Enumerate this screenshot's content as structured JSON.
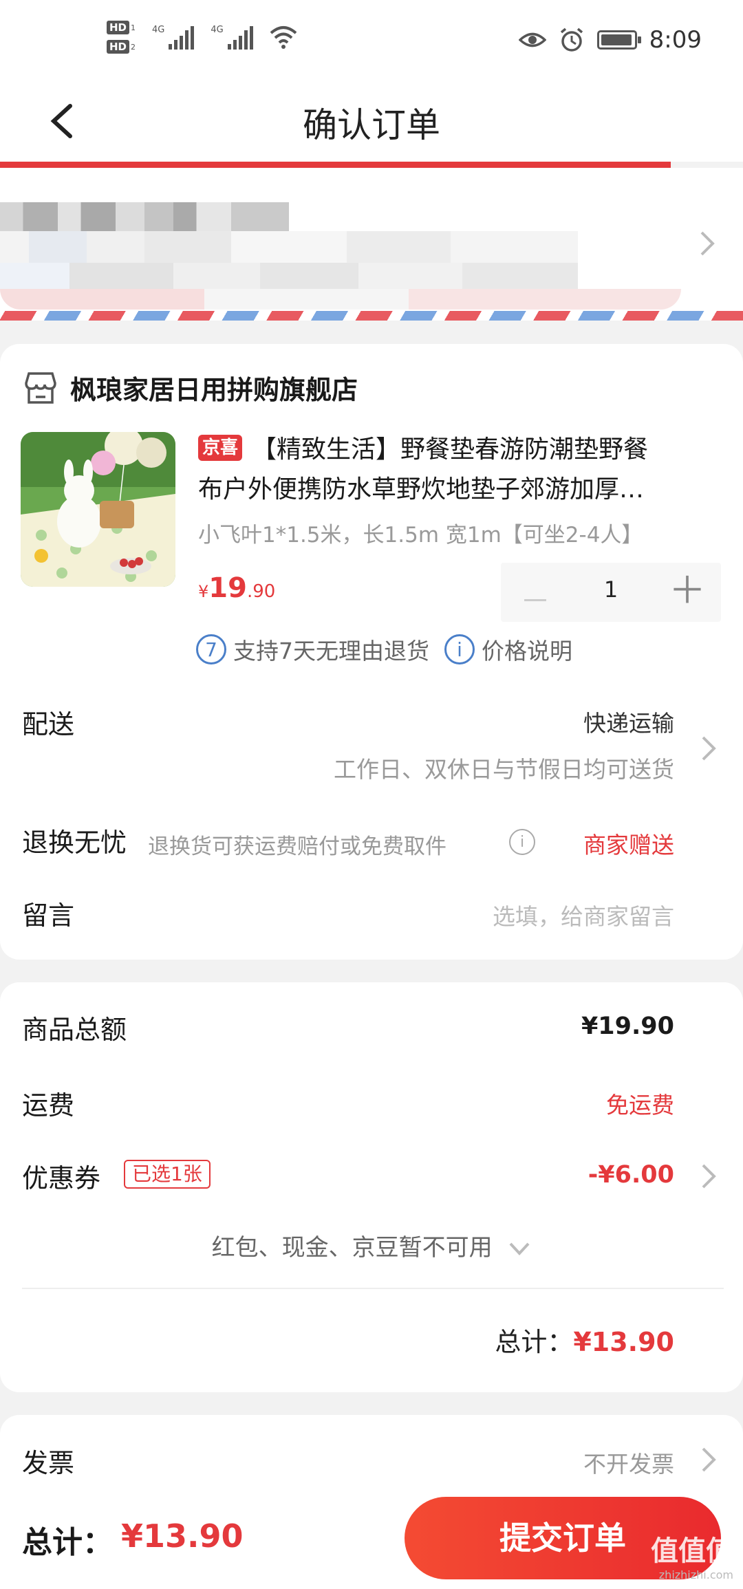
{
  "status_bar": {
    "hd1": "HD",
    "hd1_sub": "1",
    "hd2": "HD",
    "hd2_sub": "2",
    "net1": "4G",
    "net2": "4G",
    "time": "8:09"
  },
  "header": {
    "title": "确认订单"
  },
  "shop": {
    "name": "枫琅家居日用拼购旗舰店",
    "product": {
      "tag": "京喜",
      "title_line1": "【精致生活】野餐垫春游防潮垫野餐",
      "title_line2": "布户外便携防水草野炊地垫子郊游加厚…",
      "spec": "小飞叶1*1.5米，长1.5m 宽1m【可坐2-4人】",
      "price_symbol": "¥",
      "price_int": "19",
      "price_dec": ".90",
      "quantity": "1",
      "minus": "－",
      "plus": "＋"
    },
    "services": {
      "return_icon": "7",
      "return_text": "支持7天无理由退货",
      "info_icon": "i",
      "price_text": "价格说明"
    }
  },
  "delivery": {
    "label": "配送",
    "method": "快递运输",
    "note": "工作日、双休日与节假日均可送货"
  },
  "returns": {
    "label": "退换无忧",
    "note": "退换货可获运费赔付或免费取件",
    "info_icon": "i",
    "value": "商家赠送"
  },
  "message": {
    "label": "留言",
    "placeholder": "选填，给商家留言"
  },
  "summary": {
    "goods_label": "商品总额",
    "goods_value": "¥19.90",
    "shipping_label": "运费",
    "shipping_value": "免运费",
    "coupon_label": "优惠券",
    "coupon_badge": "已选1张",
    "coupon_value": "-¥6.00",
    "unavailable": "红包、现金、京豆暂不可用",
    "total_label": "总计：",
    "total_value": "¥13.90"
  },
  "invoice": {
    "label": "发票",
    "value": "不开发票"
  },
  "footer": {
    "total_label": "总计：",
    "total_value": "¥13.90",
    "submit": "提交订单",
    "watermark": "值值值",
    "watermark_url": "zhizhizhi.com"
  },
  "colors": {
    "accent": "#e4393c",
    "link_blue": "#4a7fc9"
  }
}
